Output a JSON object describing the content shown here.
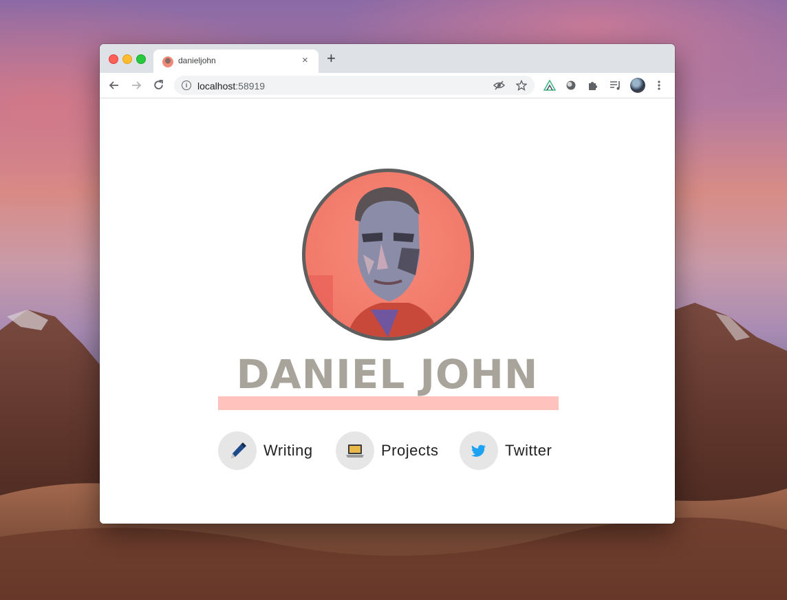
{
  "browser": {
    "tab_title": "danieljohn",
    "new_tab_label": "+",
    "close_tab_label": "×",
    "url_host": "localhost",
    "url_port": ":58919"
  },
  "profile": {
    "name": "DANIEL JOHN"
  },
  "links": [
    {
      "label": "Writing",
      "icon": "pen-icon"
    },
    {
      "label": "Projects",
      "icon": "laptop-icon"
    },
    {
      "label": "Twitter",
      "icon": "twitter-bird-icon"
    }
  ],
  "colors": {
    "name_text": "#a9a49b",
    "underline": "#ffc2bd",
    "avatar_border": "#5f5f5f",
    "avatar_bg": "#f27c6c",
    "twitter_blue": "#1da1f2"
  }
}
